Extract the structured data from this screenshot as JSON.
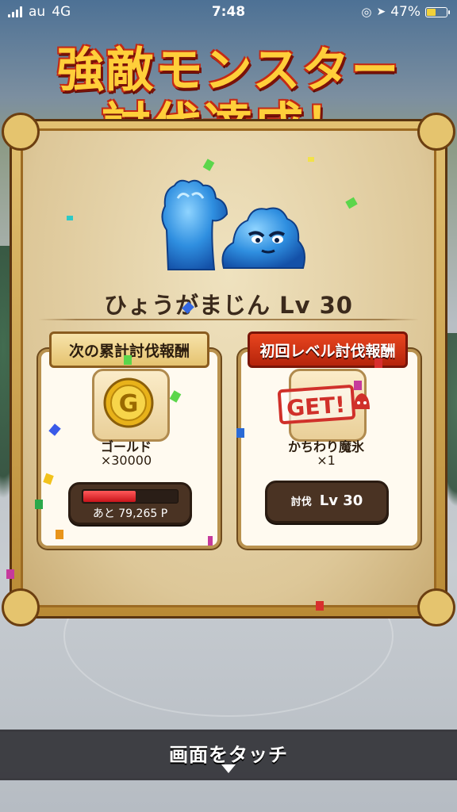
{
  "status_bar": {
    "carrier": "au",
    "network": "4G",
    "time": "7:48",
    "battery_percent": "47%",
    "battery_level": 0.47
  },
  "title": {
    "line1": "強敵モンスター",
    "line2": "討伐達成！"
  },
  "monster": {
    "name": "ひょうがまじん Lv 30",
    "icon": "ice-golem-monster-icon"
  },
  "cards": {
    "left": {
      "header": "次の累計討伐報酬",
      "item_icon": "gold-coin-icon",
      "item_name": "ゴールド",
      "quantity": "×30000",
      "progress_text": "あと 79,265 P",
      "progress_fraction": 0.55
    },
    "right": {
      "header": "初回レベル討伐報酬",
      "item_icon": "get-stamp-icon",
      "stamp_text": "GET!",
      "item_name": "かちわり魔氷",
      "quantity": "×1",
      "level_label": "討伐",
      "level_value": "Lv 30"
    }
  },
  "bottom": {
    "touch_label": "画面をタッチ"
  },
  "colors": {
    "title_fill": "#ffcf3a",
    "title_outline": "#c52a14",
    "panel_frame": "#b98a35",
    "progress_bar": "#c8141a",
    "header_red": "#c52a14"
  }
}
